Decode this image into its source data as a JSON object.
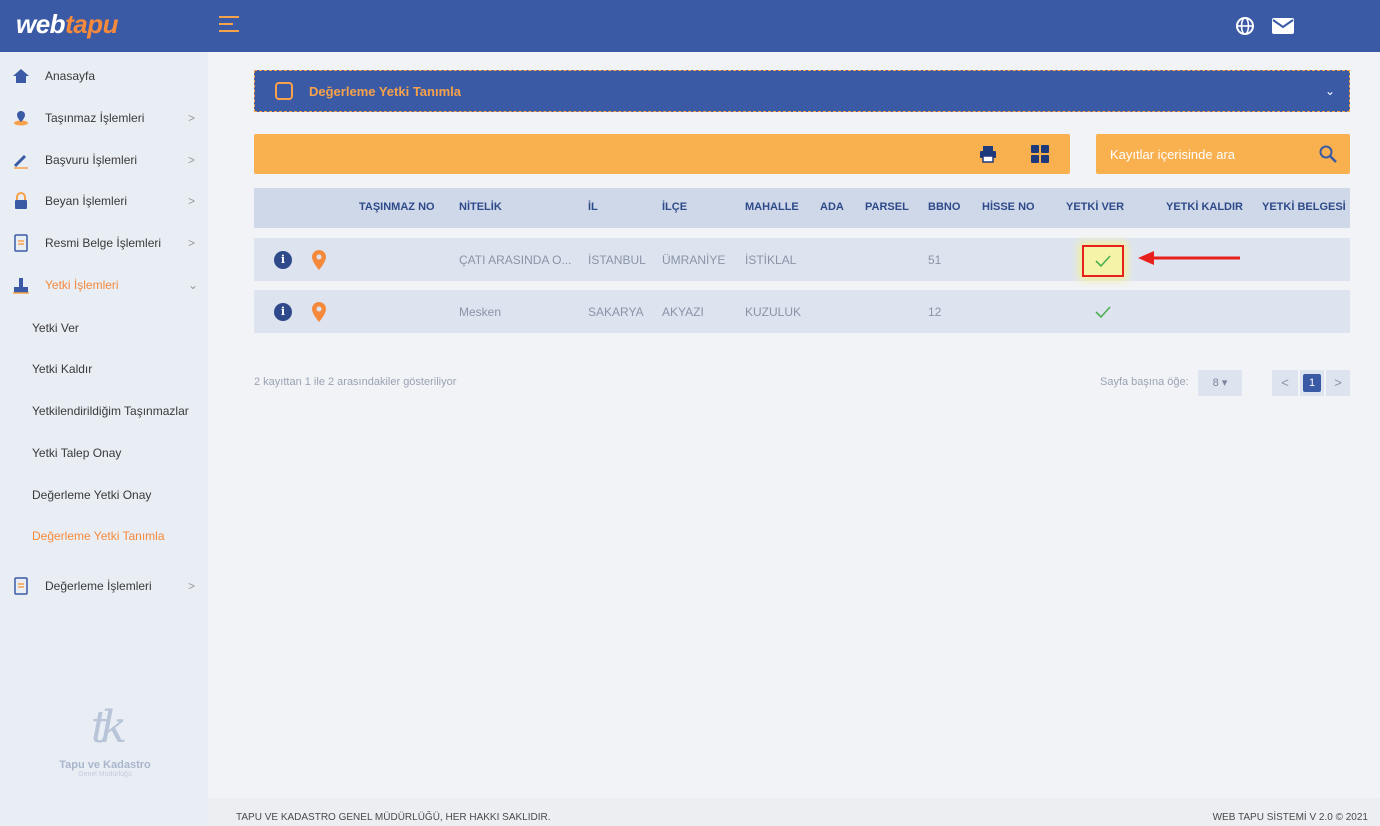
{
  "header": {
    "logo_prefix": "web",
    "logo_suffix": "tapu"
  },
  "sidebar": {
    "items": [
      {
        "label": "Anasayfa",
        "icon": "home-icon"
      },
      {
        "label": "Taşınmaz İşlemleri",
        "icon": "map-marker-icon"
      },
      {
        "label": "Başvuru İşlemleri",
        "icon": "pen-icon"
      },
      {
        "label": "Beyan İşlemleri",
        "icon": "lock-icon"
      },
      {
        "label": "Resmi Belge İşlemleri",
        "icon": "document-icon"
      },
      {
        "label": "Yetki İşlemleri",
        "icon": "user-icon"
      },
      {
        "label": "Değerleme İşlemleri",
        "icon": "document-icon"
      }
    ],
    "sub_items": [
      "Yetki Ver",
      "Yetki Kaldır",
      "Yetkilendirildiğim Taşınmazlar",
      "Yetki Talep Onay",
      "Değerleme Yetki Onay",
      "Değerleme Yetki Tanımla"
    ],
    "org_name": "Tapu ve Kadastro",
    "org_sub": "Genel Müdürlüğü"
  },
  "main": {
    "title": "Değerleme Yetki Tanımla",
    "search_placeholder": "Kayıtlar içerisinde ara"
  },
  "table": {
    "columns": [
      "TAŞINMAZ NO",
      "NİTELİK",
      "İL",
      "İLÇE",
      "MAHALLE",
      "ADA",
      "PARSEL",
      "BBNO",
      "HİSSE NO",
      "YETKİ VER",
      "YETKİ KALDIR",
      "YETKİ BELGESİ"
    ],
    "rows": [
      {
        "nitelik": "ÇATI ARASINDA O...",
        "il": "İSTANBUL",
        "ilce": "ÜMRANİYE",
        "mahalle": "İSTİKLAL",
        "bbno": "51",
        "yetki_ver": true
      },
      {
        "nitelik": "Mesken",
        "il": "SAKARYA",
        "ilce": "AKYAZI",
        "mahalle": "KUZULUK",
        "bbno": "12",
        "yetki_ver": true
      }
    ]
  },
  "pagination": {
    "info": "2 kayıttan 1 ile 2 arasındakiler gösteriliyor",
    "page_size_label": "Sayfa başına öğe:",
    "page_size": "8 ▾",
    "current_page": "1",
    "prev": "<",
    "next": ">"
  },
  "footer": {
    "left": "TAPU VE KADASTRO GENEL MÜDÜRLÜĞÜ, HER HAKKI SAKLIDIR.",
    "right": "WEB TAPU SİSTEMİ V 2.0 © 2021"
  },
  "colors": {
    "primary": "#3b5aa6",
    "accent": "#f7a24a",
    "highlight_border": "#e8201c",
    "check": "#4caf50"
  }
}
